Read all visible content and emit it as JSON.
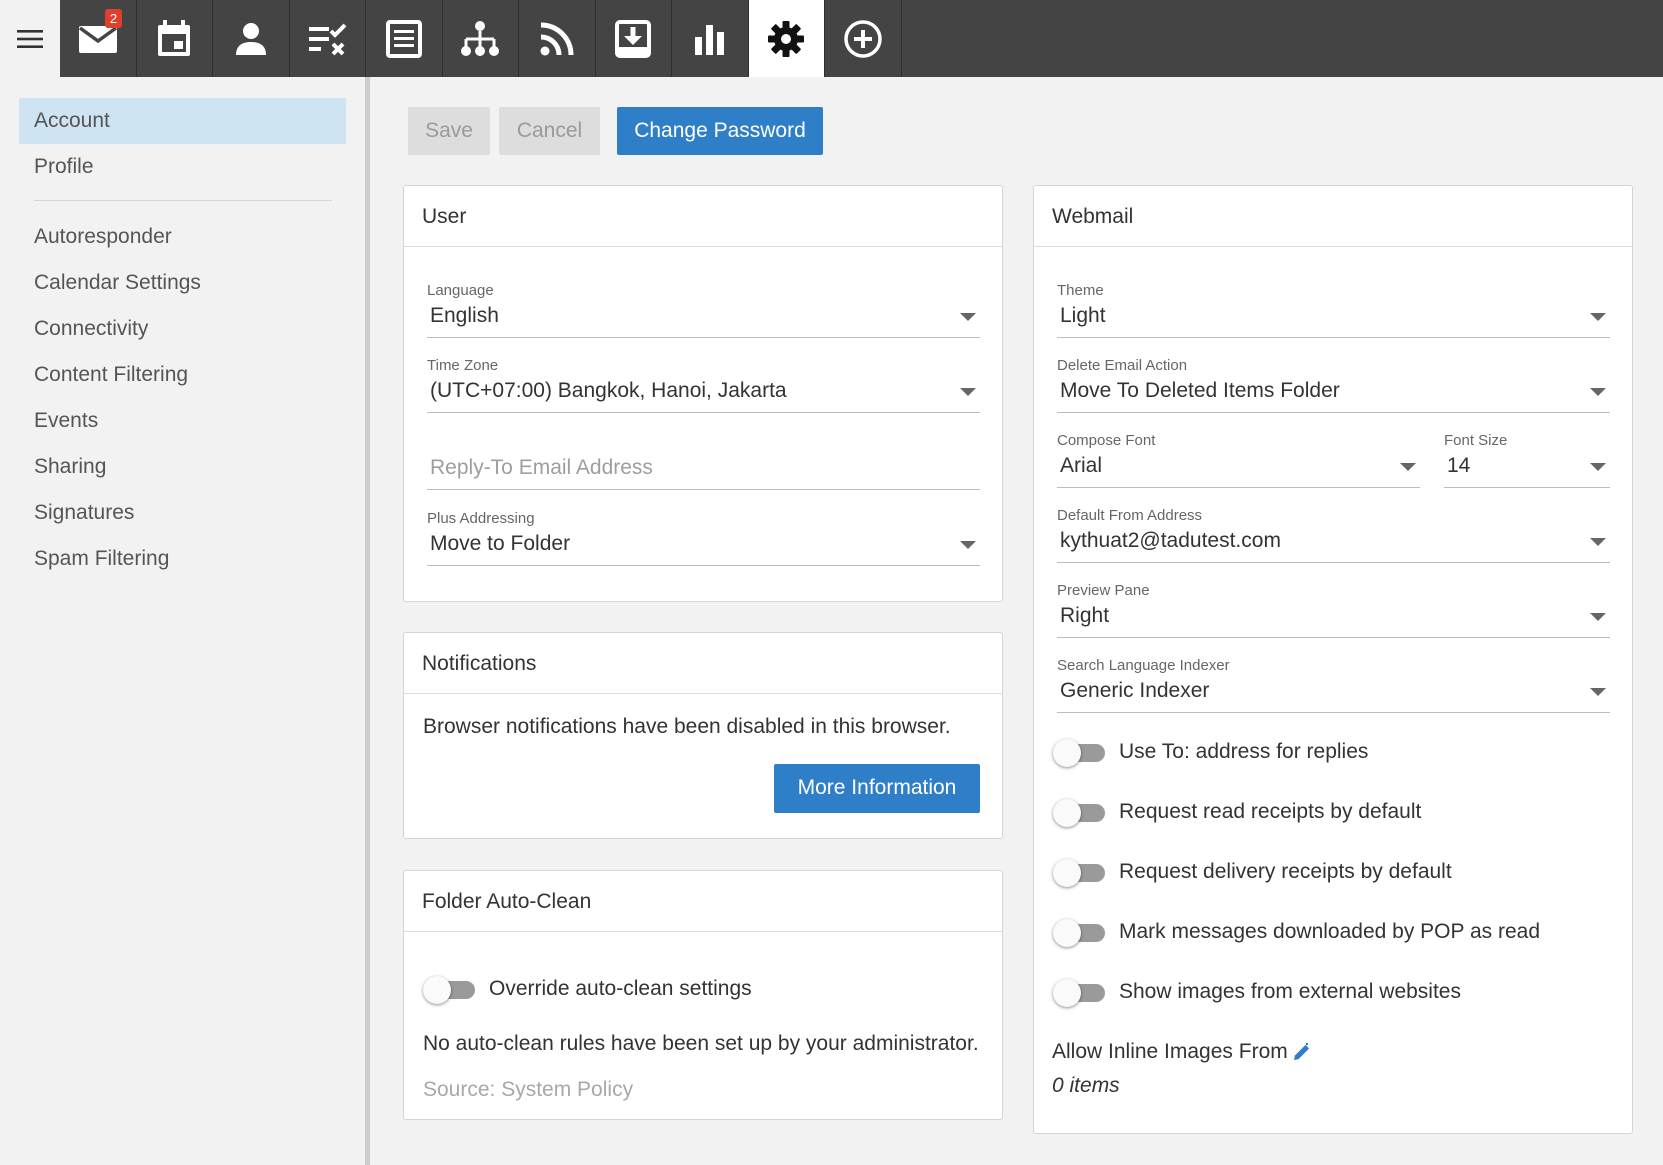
{
  "nav": {
    "mail_badge": "2",
    "icons": [
      "menu-icon",
      "mail-icon",
      "calendar-icon",
      "contact-icon",
      "tasks-icon",
      "notes-icon",
      "sitemap-icon",
      "rss-icon",
      "download-icon",
      "chart-icon",
      "settings-icon",
      "add-circle-icon"
    ],
    "active": "settings-icon"
  },
  "sidebar": {
    "items": [
      {
        "label": "Account",
        "active": true
      },
      {
        "label": "Profile"
      },
      {
        "label": "Autoresponder"
      },
      {
        "label": "Calendar Settings"
      },
      {
        "label": "Connectivity"
      },
      {
        "label": "Content Filtering"
      },
      {
        "label": "Events"
      },
      {
        "label": "Sharing"
      },
      {
        "label": "Signatures"
      },
      {
        "label": "Spam Filtering"
      }
    ]
  },
  "toolbar": {
    "save_label": "Save",
    "cancel_label": "Cancel",
    "change_password_label": "Change Password"
  },
  "user": {
    "title": "User",
    "language_label": "Language",
    "language_value": "English",
    "timezone_label": "Time Zone",
    "timezone_value": "(UTC+07:00) Bangkok, Hanoi, Jakarta",
    "reply_to_placeholder": "Reply-To Email Address",
    "plus_label": "Plus Addressing",
    "plus_value": "Move to Folder"
  },
  "notifications": {
    "title": "Notifications",
    "message": "Browser notifications have been disabled in this browser.",
    "more_info_label": "More Information"
  },
  "autoclean": {
    "title": "Folder Auto-Clean",
    "override_label": "Override auto-clean settings",
    "override_on": false,
    "message": "No auto-clean rules have been set up by your administrator.",
    "source": "Source: System Policy"
  },
  "webmail": {
    "title": "Webmail",
    "theme_label": "Theme",
    "theme_value": "Light",
    "delete_label": "Delete Email Action",
    "delete_value": "Move To Deleted Items Folder",
    "font_label": "Compose Font",
    "font_value": "Arial",
    "size_label": "Font Size",
    "size_value": "14",
    "from_label": "Default From Address",
    "from_value": "kythuat2@tadutest.com",
    "preview_label": "Preview Pane",
    "preview_value": "Right",
    "indexer_label": "Search Language Indexer",
    "indexer_value": "Generic Indexer",
    "toggles": [
      {
        "label": "Use To: address for replies",
        "on": false
      },
      {
        "label": "Request read receipts by default",
        "on": false
      },
      {
        "label": "Request delivery receipts by default",
        "on": false
      },
      {
        "label": "Mark messages downloaded by POP as read",
        "on": false
      },
      {
        "label": "Show images from external websites",
        "on": false
      }
    ],
    "inline_images_label": "Allow Inline Images From",
    "inline_images_count": "0 items"
  },
  "colors": {
    "topbar": "#444444",
    "accent": "#2e7fc7",
    "sidebar_active": "#cfe4f3",
    "badge": "#e0402b"
  }
}
